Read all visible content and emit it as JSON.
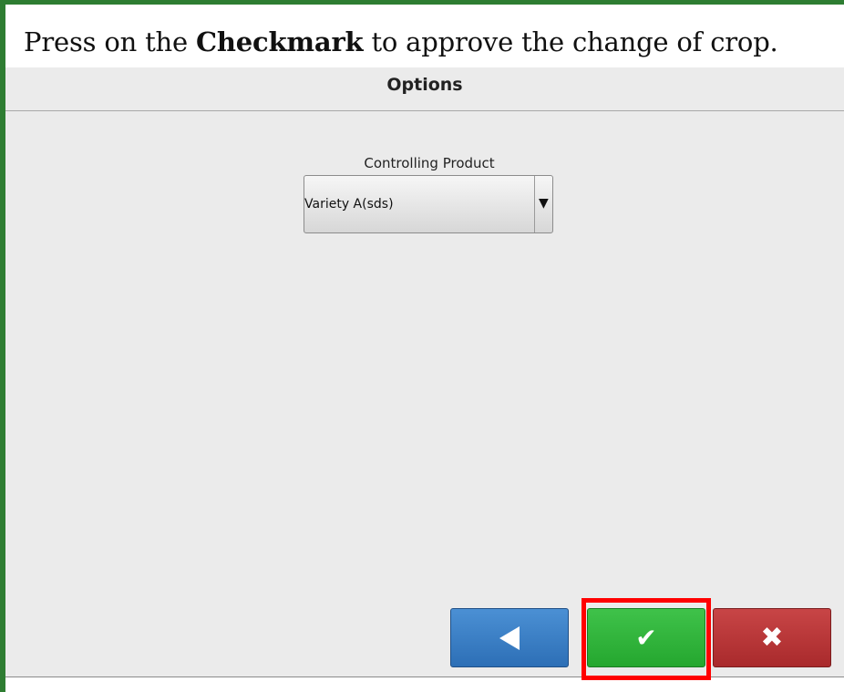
{
  "instruction": {
    "prefix": "Press on the ",
    "emphasis": "Checkmark",
    "suffix": " to approve the change of crop."
  },
  "screen": {
    "title": "Options",
    "controlling_product": {
      "label": "Controlling Product",
      "selected_value": "Variety A(sds)",
      "arrow": "▼"
    },
    "buttons": {
      "back_icon": "back-arrow-icon",
      "confirm_icon": "checkmark-icon",
      "confirm_glyph": "✔",
      "cancel_icon": "close-icon",
      "cancel_glyph": "✖"
    }
  },
  "colors": {
    "frame": "#2e7d32",
    "back": "#2d6fb6",
    "confirm": "#25a72f",
    "cancel": "#a92a2c",
    "highlight": "#ff0000"
  }
}
